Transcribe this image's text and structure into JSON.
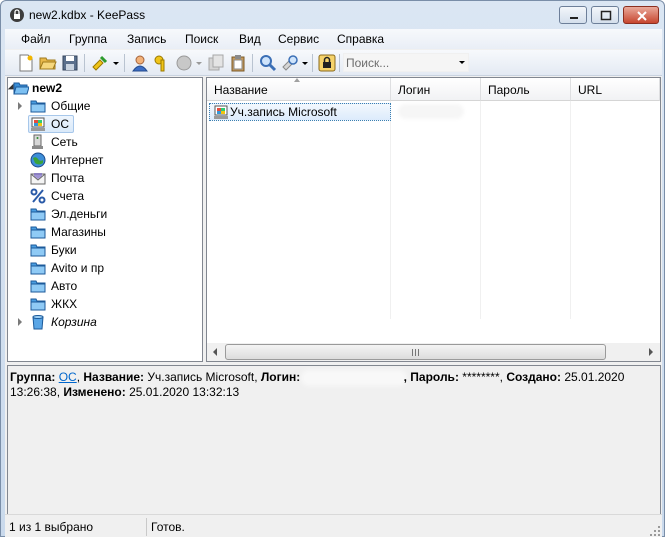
{
  "window": {
    "title": "new2.kdbx - KeePass"
  },
  "menu": [
    "Файл",
    "Группа",
    "Запись",
    "Поиск",
    "Вид",
    "Сервис",
    "Справка"
  ],
  "toolbar": {
    "search_placeholder": "Поиск..."
  },
  "tree": {
    "root": "new2",
    "groups": [
      {
        "label": "Общие",
        "icon": "folder-icon",
        "expandable": true
      },
      {
        "label": "ОС",
        "icon": "computer-icon",
        "selected": true
      },
      {
        "label": "Сеть",
        "icon": "network-icon"
      },
      {
        "label": "Интернет",
        "icon": "globe-icon"
      },
      {
        "label": "Почта",
        "icon": "mail-icon"
      },
      {
        "label": "Счета",
        "icon": "percent-icon"
      },
      {
        "label": "Эл.деньги",
        "icon": "folder-icon"
      },
      {
        "label": "Магазины",
        "icon": "folder-icon"
      },
      {
        "label": "Буки",
        "icon": "folder-icon"
      },
      {
        "label": "Avito и пр",
        "icon": "folder-icon"
      },
      {
        "label": "Авто",
        "icon": "folder-icon"
      },
      {
        "label": "ЖКХ",
        "icon": "folder-icon"
      },
      {
        "label": "Корзина",
        "icon": "recycle-bin-icon",
        "expandable": true,
        "italic": true
      }
    ]
  },
  "list": {
    "columns": [
      "Название",
      "Логин",
      "Пароль",
      "URL"
    ],
    "entries": [
      {
        "title": "Уч.запись Microsoft"
      }
    ]
  },
  "details": {
    "group_label": "Группа:",
    "group_value": "ОС",
    "title_label": "Название:",
    "title_value": "Уч.запись Microsoft,",
    "login_label": "Логин:",
    "password_label": ", Пароль:",
    "password_value": "********,",
    "created_label": "Создано:",
    "created_value": "25.01.2020 13:26:38,",
    "modified_label": "Изменено:",
    "modified_value": "25.01.2020 13:32:13"
  },
  "status": {
    "selection": "1 из 1 выбрано",
    "state": "Готов."
  },
  "colors": {
    "link": "#0066cc",
    "selection": "#d9e9f9"
  }
}
